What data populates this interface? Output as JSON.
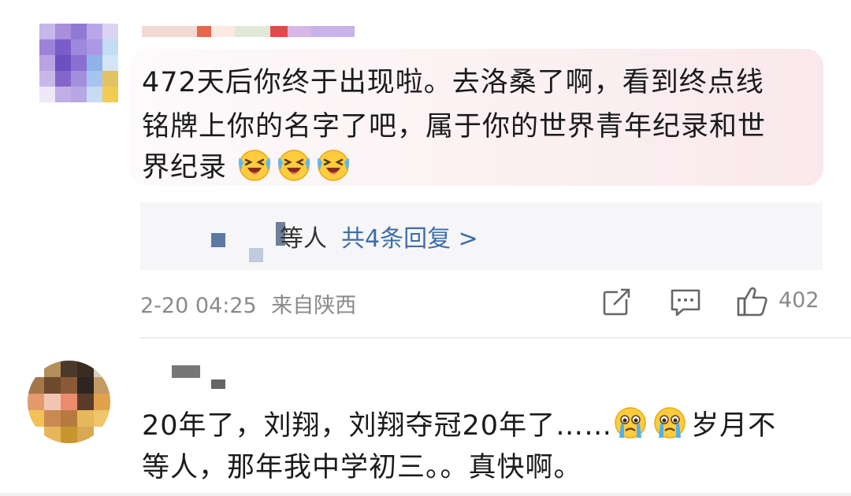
{
  "comments": [
    {
      "lines": [
        "472天后你终于出现啦。去洛桑了啊，看到终点线",
        "铭牌上你的名字了吧，属于你的世界青年纪录和世",
        "界纪录"
      ],
      "emoji_icon": "laughing-crying-emoji",
      "emoji_count": 3,
      "reply_preview": {
        "suffix_text": "等人",
        "link_text": "共4条回复 >"
      },
      "timestamp": "2-20 04:25",
      "location": "来自陕西",
      "like_count": "402",
      "colors": {
        "bubble_start": "#fdfafb",
        "bubble_end": "#f9e8ec",
        "link": "#3f6ea8",
        "meta": "#8a8a8a"
      }
    },
    {
      "line1_before_emoji": "20年了，刘翔，刘翔夺冠20年了……",
      "emoji_icon": "crying-emoji",
      "emoji_count": 2,
      "line1_after_emoji": "岁月不",
      "line2": "等人，那年我中学初三。。真快啊。"
    }
  ]
}
